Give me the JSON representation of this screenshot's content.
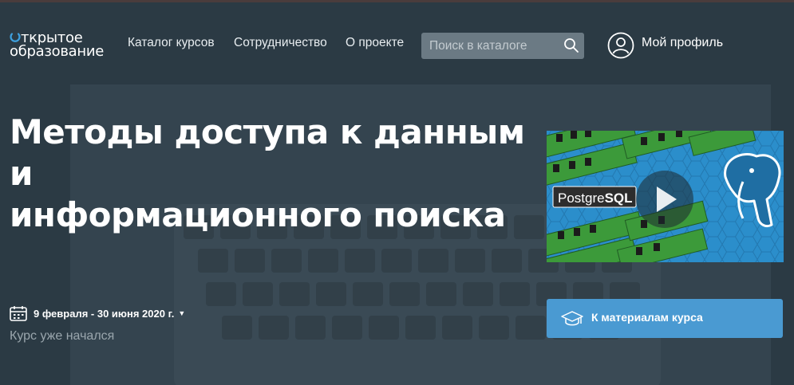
{
  "header": {
    "logo": {
      "line1": "ткрытое",
      "line2": "образование"
    },
    "nav": [
      {
        "label": "Каталог курсов"
      },
      {
        "label": "Сотрудничество"
      },
      {
        "label": "О проекте"
      }
    ],
    "search": {
      "placeholder": "Поиск в каталоге"
    },
    "profile_label": "Мой профиль"
  },
  "course": {
    "title_line1": "Методы доступа к данным и",
    "title_line2": "информационного поиска",
    "dates": "9 февраля - 30 июня 2020 г.",
    "status": "Курс уже начался",
    "cta_label": "К материалам курса",
    "video_logo_text_a": "Postgre",
    "video_logo_text_b": "SQL"
  },
  "icons": [
    "logo-ring-icon",
    "search-icon",
    "profile-icon",
    "calendar-icon",
    "caret-down-icon",
    "graduation-cap-icon",
    "play-icon",
    "elephant-icon"
  ],
  "colors": {
    "background": "#2b3a44",
    "accent": "#4a9ad2",
    "search_bg": "#6b7a84",
    "muted_text": "#9aa6ad"
  }
}
